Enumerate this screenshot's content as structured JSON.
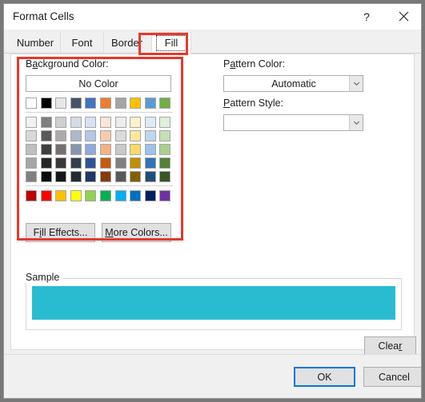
{
  "window": {
    "title": "Format Cells",
    "help_icon": "question-mark-icon",
    "help_glyph": "?",
    "close_icon": "close-icon"
  },
  "tabs": [
    {
      "label": "Number",
      "active": false
    },
    {
      "label": "Font",
      "active": false
    },
    {
      "label": "Border",
      "active": false
    },
    {
      "label": "Fill",
      "active": true
    }
  ],
  "background_color": {
    "label_pre": "B",
    "label_acc": "a",
    "label_post": "ckground Color:",
    "label_full": "Background Color:",
    "no_color_button": "No Color",
    "fill_effects_pre": "F",
    "fill_effects_acc": "i",
    "fill_effects_post": "ll Effects...",
    "fill_effects_full": "Fill Effects...",
    "more_colors_pre": "",
    "more_colors_acc": "M",
    "more_colors_post": "ore Colors...",
    "more_colors_full": "More Colors..."
  },
  "palette": {
    "theme_row": [
      "#ffffff",
      "#000000",
      "#e7e6e6",
      "#44546a",
      "#4472c4",
      "#ed7d31",
      "#a5a5a5",
      "#ffc000",
      "#5b9bd5",
      "#70ad47"
    ],
    "tint_rows": [
      [
        "#f2f2f2",
        "#7f7f7f",
        "#d0cece",
        "#d6dce5",
        "#d9e2f3",
        "#fbe5d6",
        "#ededed",
        "#fff2cc",
        "#deebf7",
        "#e2efda"
      ],
      [
        "#d9d9d9",
        "#595959",
        "#aeaaaa",
        "#adb9ca",
        "#b4c7e7",
        "#f8cbad",
        "#dbdbdb",
        "#ffe699",
        "#bdd7ee",
        "#c5e0b4"
      ],
      [
        "#bfbfbf",
        "#3f3f3f",
        "#757070",
        "#8496b0",
        "#8faadc",
        "#f4b183",
        "#c9c9c9",
        "#ffd966",
        "#9dc3e6",
        "#a9d18e"
      ],
      [
        "#a6a6a6",
        "#262626",
        "#3a3838",
        "#323f4f",
        "#2f5496",
        "#c55a11",
        "#808080",
        "#bf9000",
        "#2e75b6",
        "#538135"
      ],
      [
        "#808080",
        "#0c0c0c",
        "#171616",
        "#222a35",
        "#1f3864",
        "#833c0c",
        "#595959",
        "#806000",
        "#1f4e79",
        "#375623"
      ]
    ],
    "standard_row": [
      "#c00000",
      "#ff0000",
      "#ffc000",
      "#ffff00",
      "#92d050",
      "#00b050",
      "#00b0f0",
      "#0070c0",
      "#002060",
      "#7030a0"
    ]
  },
  "pattern": {
    "color_label_pre": "P",
    "color_label_acc": "a",
    "color_label_post": "ttern Color:",
    "color_label_full": "Pattern Color:",
    "color_value": "Automatic",
    "style_label_pre": "",
    "style_label_acc": "P",
    "style_label_post": "attern Style:",
    "style_label_full": "Pattern Style:",
    "style_value": ""
  },
  "sample": {
    "legend": "Sample",
    "color": "#29bcd1"
  },
  "actions": {
    "clear_pre": "Clea",
    "clear_acc": "r",
    "clear_post": "",
    "clear_full": "Clear",
    "ok": "OK",
    "cancel": "Cancel"
  },
  "annotations": {
    "fill_tab_highlight_color": "#e8382a",
    "background_color_highlight_color": "#e8382a"
  }
}
